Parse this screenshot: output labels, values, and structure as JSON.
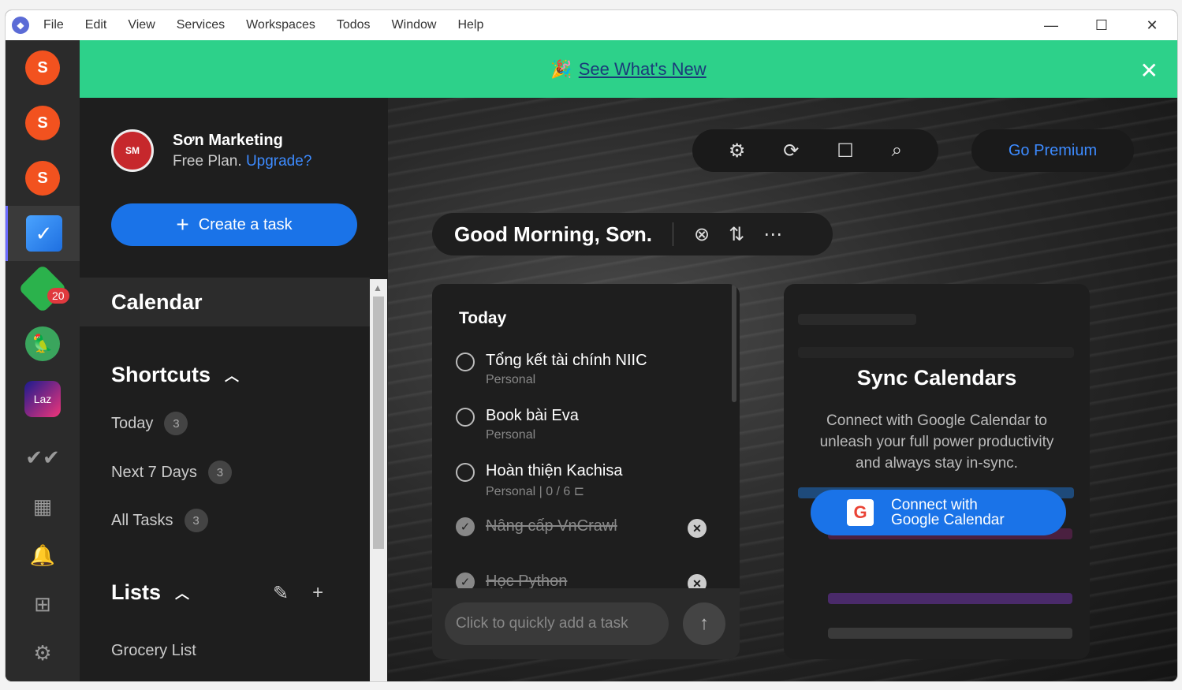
{
  "menu": [
    "File",
    "Edit",
    "View",
    "Services",
    "Workspaces",
    "Todos",
    "Window",
    "Help"
  ],
  "window_controls": [
    "—",
    "☐",
    "✕"
  ],
  "rail": {
    "shopee_glyph": "S",
    "feedly_badge": "20",
    "laz_label": "Laz"
  },
  "banner": {
    "label": "See What's New",
    "icon": "party-popper-icon"
  },
  "profile": {
    "name": "Sơn Marketing",
    "plan": "Free Plan.",
    "upgrade": "Upgrade?"
  },
  "sidebar": {
    "create_label": "Create a task",
    "calendar_label": "Calendar",
    "shortcuts_label": "Shortcuts",
    "shortcuts": [
      {
        "label": "Today",
        "count": "3"
      },
      {
        "label": "Next 7 Days",
        "count": "3"
      },
      {
        "label": "All Tasks",
        "count": "3"
      }
    ],
    "lists_label": "Lists",
    "lists": [
      "Grocery List"
    ]
  },
  "greeting": "Good Morning, Sơn.",
  "premium_label": "Go Premium",
  "today_panel": {
    "title": "Today",
    "tasks": [
      {
        "title": "Tổng kết tài chính NIIC",
        "sub": "Personal"
      },
      {
        "title": "Book bài Eva",
        "sub": "Personal"
      },
      {
        "title": "Hoàn thiện Kachisa",
        "sub": "Personal  |  0 / 6"
      },
      {
        "title": "Nâng cấp VnCrawl",
        "sub": ""
      },
      {
        "title": "Học Python",
        "sub": ""
      }
    ],
    "quick_placeholder": "Click to quickly add a task"
  },
  "sync": {
    "title": "Sync Calendars",
    "desc": "Connect with Google Calendar to unleash your full power productivity and always stay in-sync.",
    "btn_line1": "Connect with",
    "btn_line2": "Google Calendar"
  }
}
